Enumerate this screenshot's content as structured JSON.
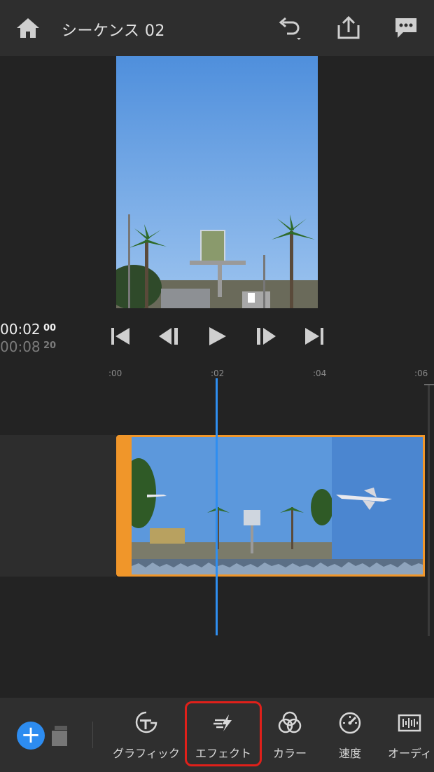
{
  "header": {
    "title": "シーケンス 02",
    "home_icon": "home-icon",
    "undo_icon": "undo-icon",
    "share_icon": "share-icon",
    "feedback_icon": "feedback-icon"
  },
  "timecode": {
    "current": "00:02",
    "current_frames": "00",
    "total": "00:08",
    "total_frames": "20"
  },
  "transport": [
    "skip-to-start-icon",
    "step-back-icon",
    "play-icon",
    "step-forward-icon",
    "skip-to-end-icon"
  ],
  "ruler": {
    "labels": [
      ":00",
      ":02",
      ":04",
      ":06"
    ]
  },
  "toolbar": {
    "add_label": "+",
    "tools": [
      {
        "label": "グラフィック",
        "icon": "graphics-icon"
      },
      {
        "label": "エフェクト",
        "icon": "effects-icon",
        "selected": true
      },
      {
        "label": "カラー",
        "icon": "color-icon"
      },
      {
        "label": "速度",
        "icon": "speed-icon"
      },
      {
        "label": "オーディ",
        "icon": "audio-icon"
      }
    ]
  },
  "colors": {
    "accent": "#2d8cf0",
    "clip_border": "#f0962a",
    "highlight": "#e0201a",
    "background": "#232323"
  }
}
